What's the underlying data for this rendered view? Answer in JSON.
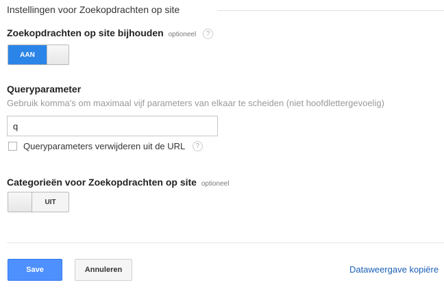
{
  "section": {
    "title": "Instellingen voor Zoekopdrachten op site"
  },
  "tracking": {
    "label": "Zoekopdrachten op site bijhouden",
    "optional": "optioneel",
    "help": "?",
    "toggle": {
      "state": "on",
      "label": "AAN"
    }
  },
  "query": {
    "label": "Queryparameter",
    "hint": "Gebruik komma's om maximaal vijf parameters van elkaar te scheiden (niet hoofdlettergevoelig)",
    "value": "q",
    "remove_label": "Queryparameters verwijderen uit de URL",
    "remove_checked": false,
    "help": "?"
  },
  "categories": {
    "label": "Categorieën voor Zoekopdrachten op site",
    "optional": "optioneel",
    "toggle": {
      "state": "off",
      "label": "UIT"
    }
  },
  "actions": {
    "save": "Save",
    "cancel": "Annuleren",
    "copy_link": "Dataweergave kopiëre"
  },
  "colors": {
    "accent": "#2b85e8",
    "primary_button": "#4d90fe",
    "link": "#1a5fb4"
  }
}
